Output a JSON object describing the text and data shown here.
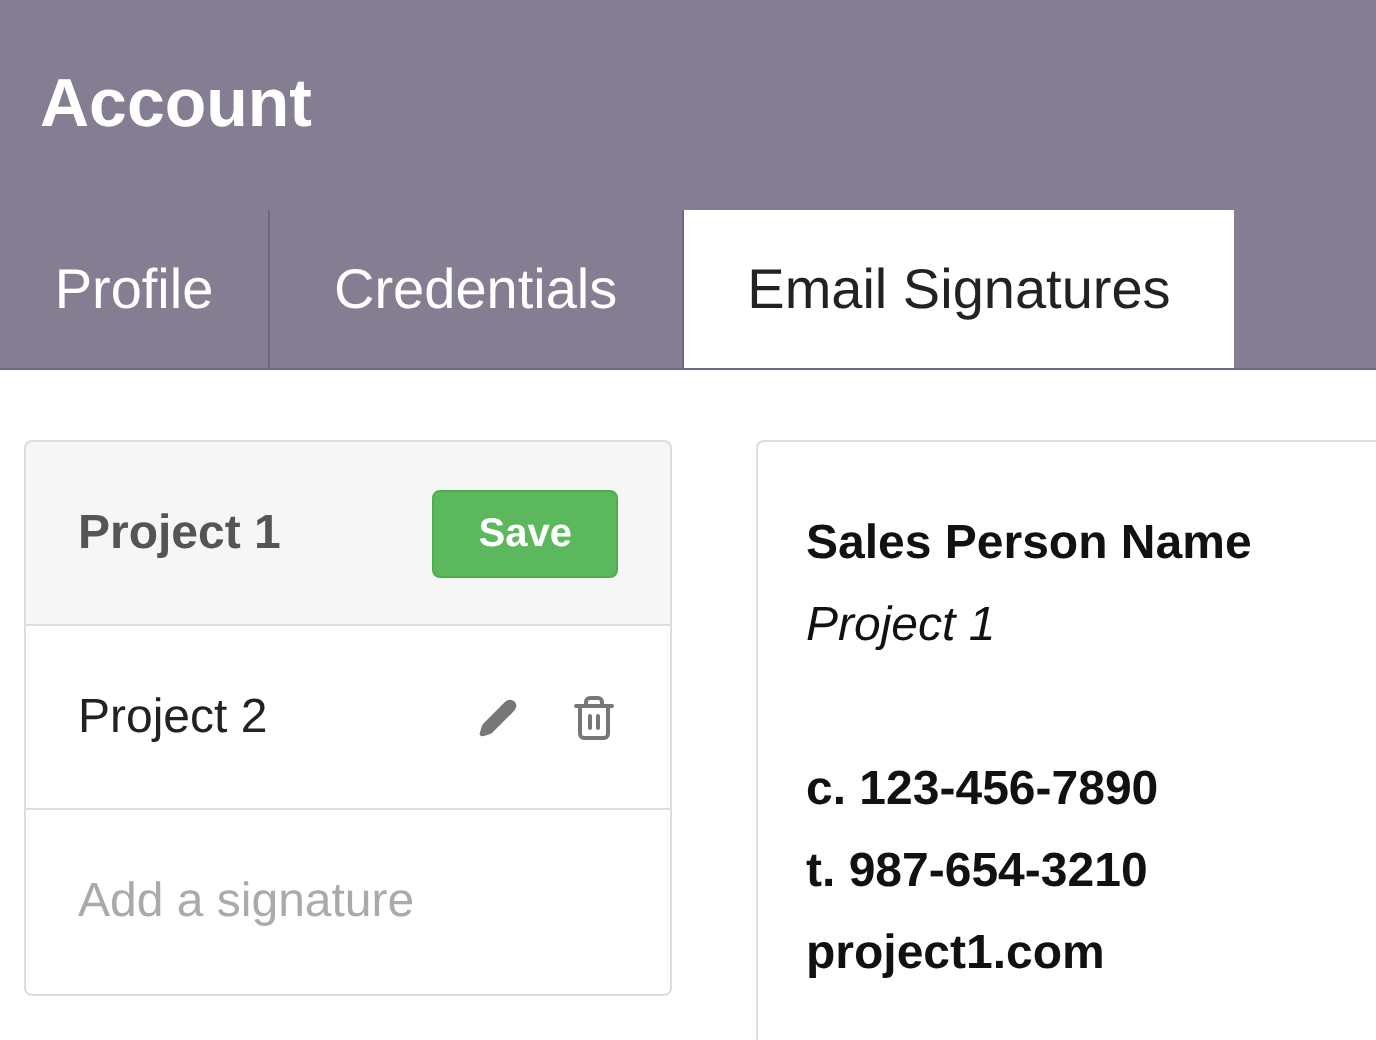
{
  "header": {
    "title": "Account"
  },
  "tabs": [
    {
      "label": "Profile",
      "selected": false
    },
    {
      "label": "Credentials",
      "selected": false
    },
    {
      "label": "Email Signatures",
      "selected": true
    }
  ],
  "signatures": [
    {
      "name": "Project 1",
      "selected": true,
      "action": "Save"
    },
    {
      "name": "Project 2",
      "selected": false
    }
  ],
  "add_field": {
    "placeholder": "Add a signature"
  },
  "preview": {
    "name": "Sales Person Name",
    "project": "Project 1",
    "contacts": [
      "c. 123-456-7890",
      "t. 987-654-3210",
      "project1.com"
    ]
  }
}
